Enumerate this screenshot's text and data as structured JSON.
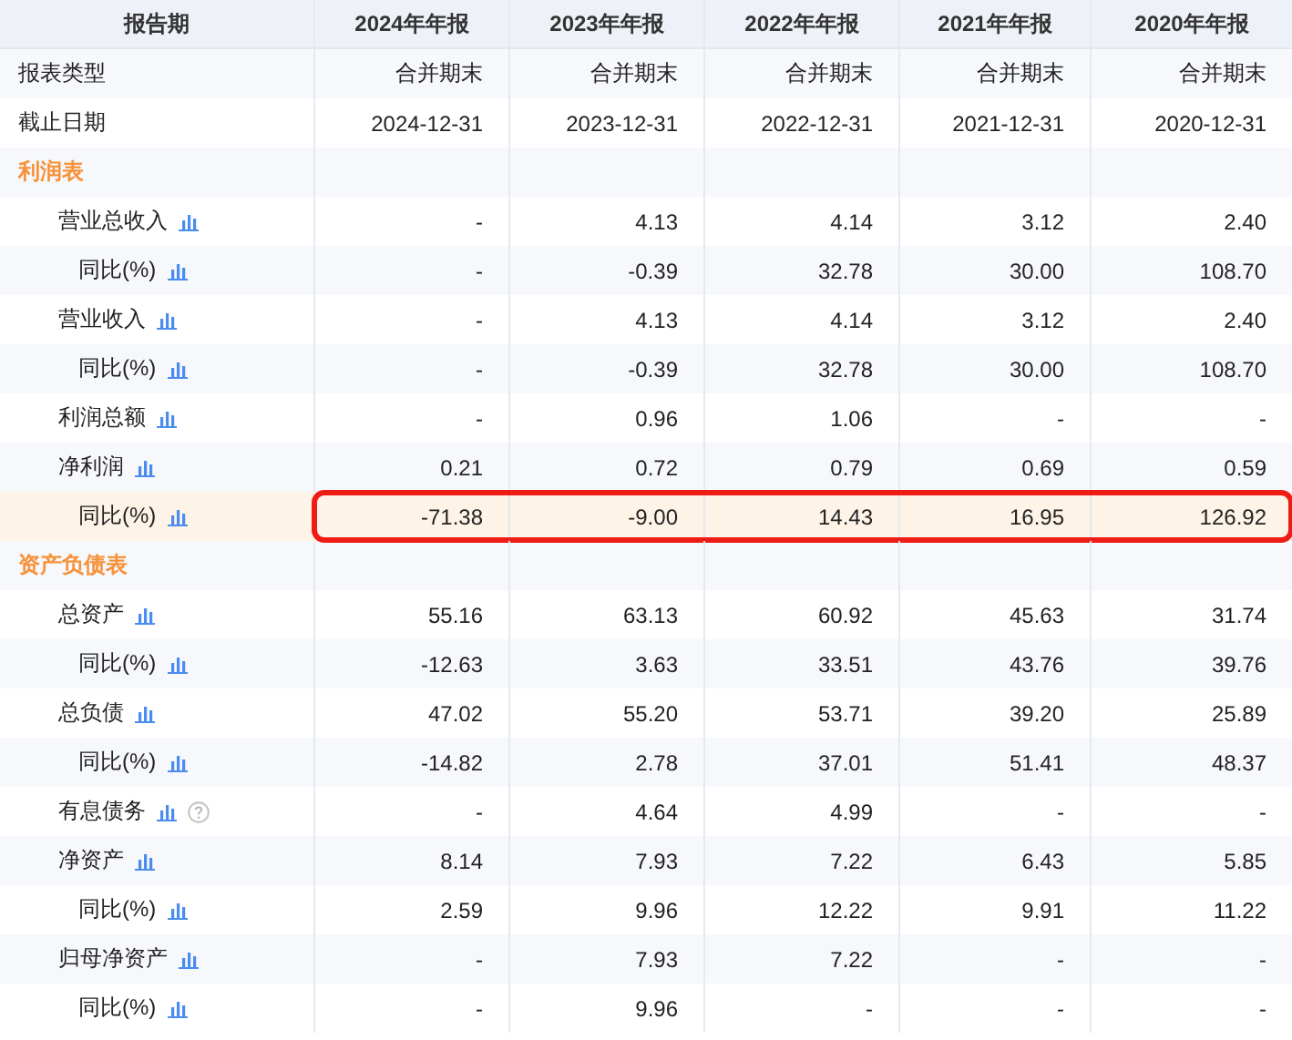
{
  "header": {
    "label": "报告期",
    "columns": [
      "2024年年报",
      "2023年年报",
      "2022年年报",
      "2021年年报",
      "2020年年报"
    ]
  },
  "rows": [
    {
      "kind": "meta",
      "label": "报表类型",
      "values": [
        "合并期末",
        "合并期末",
        "合并期末",
        "合并期末",
        "合并期末"
      ]
    },
    {
      "kind": "meta",
      "label": "截止日期",
      "values": [
        "2024-12-31",
        "2023-12-31",
        "2022-12-31",
        "2021-12-31",
        "2020-12-31"
      ]
    },
    {
      "kind": "section",
      "label": "利润表",
      "children": [
        {
          "label": "营业总收入",
          "help": false,
          "highlighted": false,
          "values": [
            "-",
            "4.13",
            "4.14",
            "3.12",
            "2.40"
          ],
          "children": [
            {
              "label": "同比(%)",
              "help": false,
              "highlighted": false,
              "values": [
                "-",
                "-0.39",
                "32.78",
                "30.00",
                "108.70"
              ]
            }
          ]
        },
        {
          "label": "营业收入",
          "help": false,
          "highlighted": false,
          "values": [
            "-",
            "4.13",
            "4.14",
            "3.12",
            "2.40"
          ],
          "children": [
            {
              "label": "同比(%)",
              "help": false,
              "highlighted": false,
              "values": [
                "-",
                "-0.39",
                "32.78",
                "30.00",
                "108.70"
              ]
            }
          ]
        },
        {
          "label": "利润总额",
          "help": false,
          "highlighted": false,
          "values": [
            "-",
            "0.96",
            "1.06",
            "-",
            "-"
          ]
        },
        {
          "label": "净利润",
          "help": false,
          "highlighted": false,
          "values": [
            "0.21",
            "0.72",
            "0.79",
            "0.69",
            "0.59"
          ],
          "children": [
            {
              "label": "同比(%)",
              "help": false,
              "highlighted": true,
              "values": [
                "-71.38",
                "-9.00",
                "14.43",
                "16.95",
                "126.92"
              ]
            }
          ]
        }
      ]
    },
    {
      "kind": "section",
      "label": "资产负债表",
      "children": [
        {
          "label": "总资产",
          "help": false,
          "highlighted": false,
          "values": [
            "55.16",
            "63.13",
            "60.92",
            "45.63",
            "31.74"
          ],
          "children": [
            {
              "label": "同比(%)",
              "help": false,
              "highlighted": false,
              "values": [
                "-12.63",
                "3.63",
                "33.51",
                "43.76",
                "39.76"
              ]
            }
          ]
        },
        {
          "label": "总负债",
          "help": false,
          "highlighted": false,
          "values": [
            "47.02",
            "55.20",
            "53.71",
            "39.20",
            "25.89"
          ],
          "children": [
            {
              "label": "同比(%)",
              "help": false,
              "highlighted": false,
              "values": [
                "-14.82",
                "2.78",
                "37.01",
                "51.41",
                "48.37"
              ]
            }
          ]
        },
        {
          "label": "有息债务",
          "help": true,
          "highlighted": false,
          "values": [
            "-",
            "4.64",
            "4.99",
            "-",
            "-"
          ]
        },
        {
          "label": "净资产",
          "help": false,
          "highlighted": false,
          "values": [
            "8.14",
            "7.93",
            "7.22",
            "6.43",
            "5.85"
          ],
          "children": [
            {
              "label": "同比(%)",
              "help": false,
              "highlighted": false,
              "values": [
                "2.59",
                "9.96",
                "12.22",
                "9.91",
                "11.22"
              ]
            }
          ]
        },
        {
          "label": "归母净资产",
          "help": false,
          "highlighted": false,
          "values": [
            "-",
            "7.93",
            "7.22",
            "-",
            "-"
          ],
          "children": [
            {
              "label": "同比(%)",
              "help": false,
              "highlighted": false,
              "values": [
                "-",
                "9.96",
                "-",
                "-",
                "-"
              ]
            }
          ]
        }
      ]
    }
  ]
}
